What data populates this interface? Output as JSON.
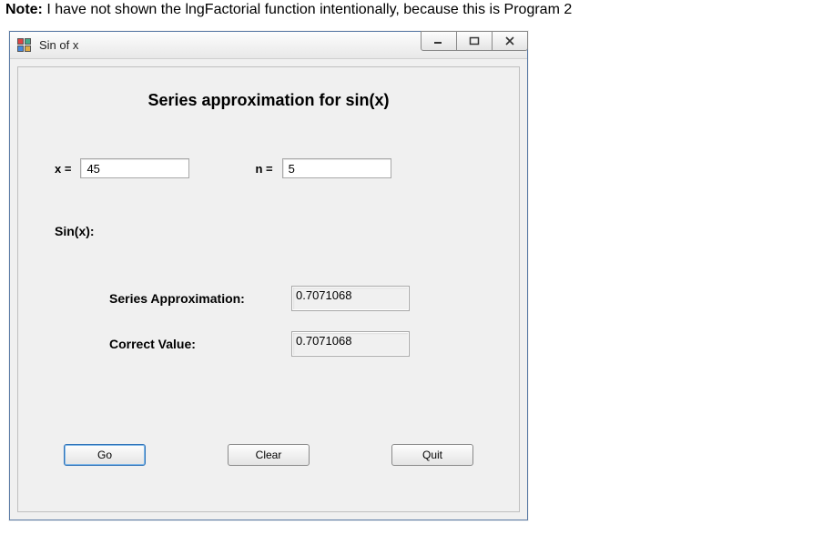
{
  "note": {
    "label": "Note:",
    "text": " I have not shown the lngFactorial function intentionally, because this is Program 2"
  },
  "window": {
    "title": "Sin of x"
  },
  "form": {
    "heading": "Series approximation for sin(x)",
    "x_label": "x =",
    "x_value": "45",
    "n_label": "n =",
    "n_value": "5",
    "sinx_label": "Sin(x):",
    "series_label": "Series Approximation:",
    "series_value": "0.7071068",
    "correct_label": "Correct Value:",
    "correct_value": "0.7071068",
    "buttons": {
      "go": "Go",
      "clear": "Clear",
      "quit": "Quit"
    }
  }
}
